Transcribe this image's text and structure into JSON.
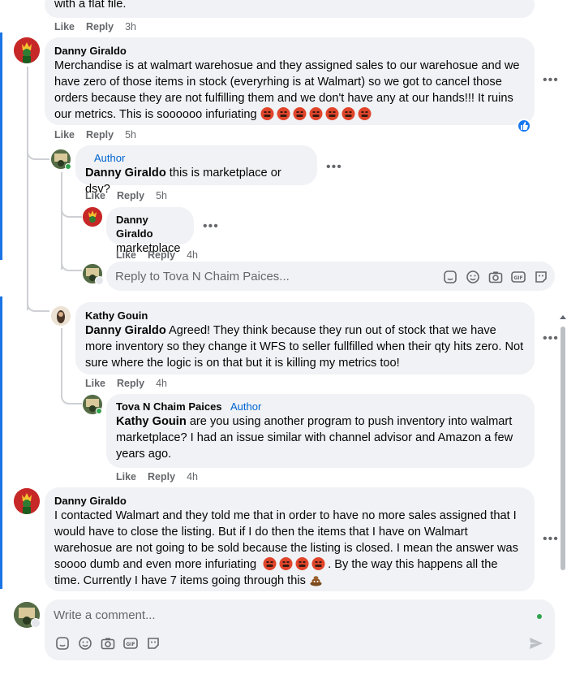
{
  "top_partial": {
    "text": "with a flat file.",
    "actions": {
      "like": "Like",
      "reply": "Reply",
      "time": "3h"
    }
  },
  "comments": [
    {
      "author": "Danny Giraldo",
      "text": "Merchandise is at walmart warehosue and they assigned sales to our warehosue and we have zero of those items in stock (everyrhing is at Walmart) so we got to cancel those orders because they are not fulfilling them and we don't have any at our hands!!! It ruins our metrics. This is soooooo infuriating",
      "emoji": "angry-face x7",
      "actions": {
        "like": "Like",
        "reply": "Reply",
        "time": "5h"
      }
    }
  ],
  "reply_author": {
    "badge": "Author",
    "mention": "Danny Giraldo",
    "text": " this is marketplace or dsv?",
    "actions": {
      "like": "Like",
      "reply": "Reply",
      "time": "5h"
    }
  },
  "reply_danny": {
    "author": "Danny Giraldo",
    "text": "marketplace",
    "actions": {
      "like": "Like",
      "reply": "Reply",
      "time": "4h"
    }
  },
  "reply_input": {
    "placeholder": "Reply to Tova N Chaim Paices..."
  },
  "reply_kathy": {
    "author": "Kathy Gouin",
    "mention": "Danny Giraldo",
    "text": " Agreed! They think because they run out of stock that we have more inventory so they change it WFS to seller fullfilled when their qty hits zero. Not sure where the logic is on that but it is killing my metrics too!",
    "actions": {
      "like": "Like",
      "reply": "Reply",
      "time": "4h"
    }
  },
  "reply_tova": {
    "author": "Tova N Chaim Paices",
    "badge": "Author",
    "mention": "Kathy Gouin",
    "text": " are you using another program to push inventory into walmart marketplace? I had an issue similar with channel advisor and Amazon a few years ago.",
    "actions": {
      "like": "Like",
      "reply": "Reply",
      "time": "4h"
    }
  },
  "comment_danny2": {
    "author": "Danny Giraldo",
    "text": "I contacted Walmart and they told me that in order to have no more sales assigned that I would have to close the listing. But if I do then the items that I have on Walmart warehosue are not going to be sold because the listing is closed. I mean the answer was soooo dumb and even more infuriating",
    "text2": ". By the way this happens all the time. Currently I have 7 items going through this",
    "emoji": "angry-face x4, poop"
  },
  "comment_input": {
    "placeholder": "Write a comment..."
  },
  "icons": {
    "more": "more-horizontal-icon",
    "like_reaction": "like-reaction-icon",
    "sticker": "sticker-icon",
    "emoji": "emoji-icon",
    "camera": "camera-icon",
    "gif": "gif-icon",
    "send": "send-icon"
  },
  "colors": {
    "accent": "#1877f2",
    "author_badge": "#0064d1",
    "bubble": "#f0f2f5",
    "muted": "#65676b"
  }
}
